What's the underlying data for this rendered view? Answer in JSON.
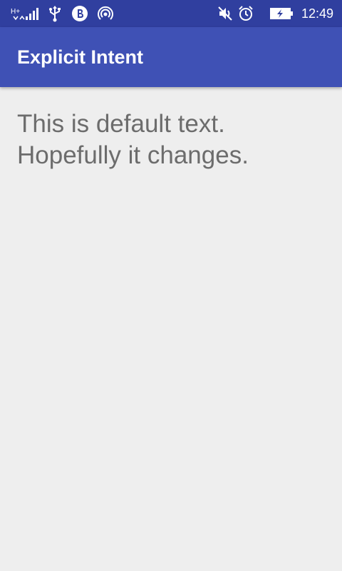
{
  "status_bar": {
    "time": "12:49",
    "network_type": "H+",
    "icons": [
      "signal-icon",
      "usb-icon",
      "b-app-icon",
      "hotspot-icon",
      "mute-icon",
      "alarm-icon",
      "battery-charging-icon"
    ],
    "background_color": "#303f9f"
  },
  "app_bar": {
    "title": "Explicit Intent",
    "background_color": "#3f51b5"
  },
  "main": {
    "text_line_1": "This is default text.",
    "text_line_2": "Hopefully it changes."
  }
}
